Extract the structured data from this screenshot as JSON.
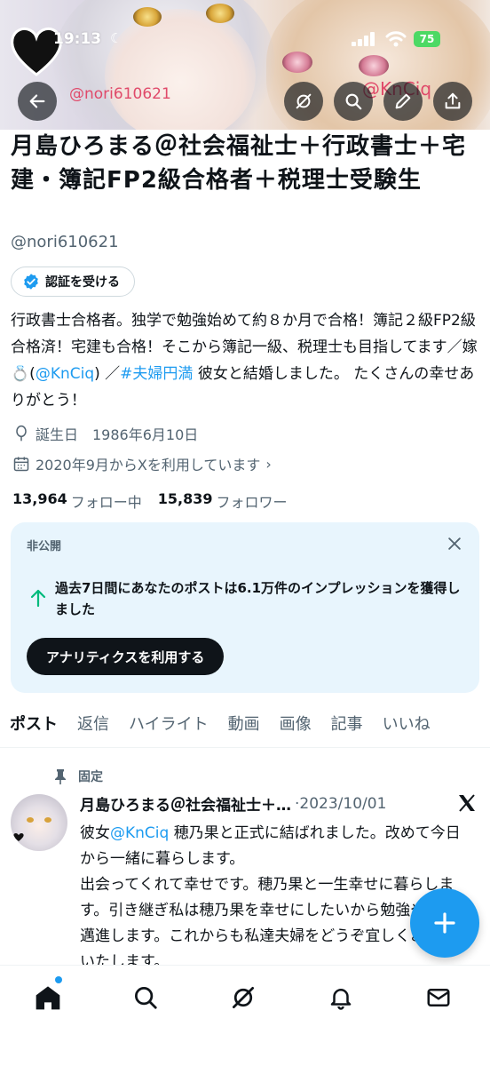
{
  "status_bar": {
    "time": "19:13",
    "battery": "75"
  },
  "banner": {
    "watermark_left": "@nori610621",
    "watermark_right": "@KnCiq"
  },
  "profile": {
    "name": "月島ひろまる＠社会福祉士＋行政書士＋宅建・簿記FP2級合格者＋税理士受験生",
    "handle": "@nori610621",
    "verify_label": "認証を受ける",
    "bio": {
      "part1": "行政書士合格者。独学で勉強始めて約８か月で合格！簿記２級FP2級合格済！宅建も合格！そこから簿記一級、税理士も目指してます／嫁💍(",
      "mention": "@KnCiq",
      "part2": ") ／",
      "hashtag": "#夫婦円満",
      "part3": " 彼女と結婚しました。 たくさんの幸せありがとう！"
    },
    "birthday": "誕生日　1986年6月10日",
    "joined": "2020年9月からXを利用しています",
    "following_count": "13,964",
    "following_label": "フォロー中",
    "followers_count": "15,839",
    "followers_label": "フォロワー"
  },
  "analytics_card": {
    "label": "非公開",
    "message": "過去7日間にあなたのポストは6.1万件のインプレッションを獲得しました",
    "button": "アナリティクスを利用する"
  },
  "tabs": [
    "ポスト",
    "返信",
    "ハイライト",
    "動画",
    "画像",
    "記事",
    "いいね"
  ],
  "post": {
    "pinned_label": "固定",
    "author": "月島ひろまる＠社会福祉士＋…",
    "date": "·2023/10/01",
    "body_prefix": "彼女",
    "body_mention": "@KnCiq",
    "body_rest": " 穂乃果と正式に結ばれました。改めて今日から一緒に暮らします。\n出会ってくれて幸せです。穂乃果と一生幸せに暮らします。引き継ぎ私は穂乃果を幸せにしたいから勉強や仕事邁進します。これからも私達夫婦をどうぞ宜しくお願いいたします。"
  },
  "icons": {
    "back": "arrow-left-icon",
    "grok": "grok-icon",
    "search": "search-icon",
    "edit": "pencil-icon",
    "share": "share-icon",
    "verified": "verified-badge-icon",
    "location": "balloon-icon",
    "calendar": "calendar-icon",
    "close": "close-icon",
    "trend": "arrow-up-icon",
    "pin": "pin-icon",
    "x": "x-logo-icon",
    "compose": "plus-icon",
    "home": "home-icon",
    "notifications": "bell-icon",
    "messages": "mail-icon"
  },
  "colors": {
    "accent": "#1d9bf0",
    "text": "#0f1419",
    "muted": "#536471",
    "card_bg": "#e8f5fd"
  }
}
